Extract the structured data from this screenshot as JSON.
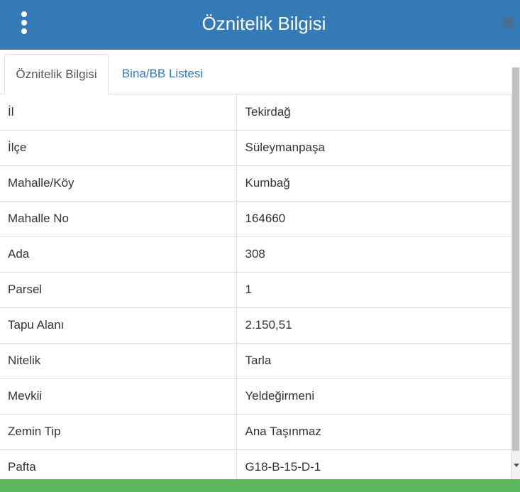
{
  "header": {
    "title": "Öznitelik Bilgisi",
    "menu_icon": "vertical-ellipsis",
    "close_icon": "close-x",
    "background_color": "#337ab7"
  },
  "tabs": [
    {
      "label": "Öznitelik Bilgisi",
      "active": true
    },
    {
      "label": "Bina/BB Listesi",
      "active": false
    }
  ],
  "attributes": [
    {
      "key": "İl",
      "value": "Tekirdağ"
    },
    {
      "key": "İlçe",
      "value": "Süleymanpaşa"
    },
    {
      "key": "Mahalle/Köy",
      "value": "Kumbağ"
    },
    {
      "key": "Mahalle No",
      "value": "164660"
    },
    {
      "key": "Ada",
      "value": "308"
    },
    {
      "key": "Parsel",
      "value": "1"
    },
    {
      "key": "Tapu Alanı",
      "value": "2.150,51"
    },
    {
      "key": "Nitelik",
      "value": "Tarla"
    },
    {
      "key": "Mevkii",
      "value": "Yeldeğirmeni"
    },
    {
      "key": "Zemin Tip",
      "value": "Ana Taşınmaz"
    },
    {
      "key": "Pafta",
      "value": "G18-B-15-D-1"
    }
  ],
  "colors": {
    "link": "#337ab7",
    "footer": "#5cb85c",
    "border": "#dddddd"
  }
}
